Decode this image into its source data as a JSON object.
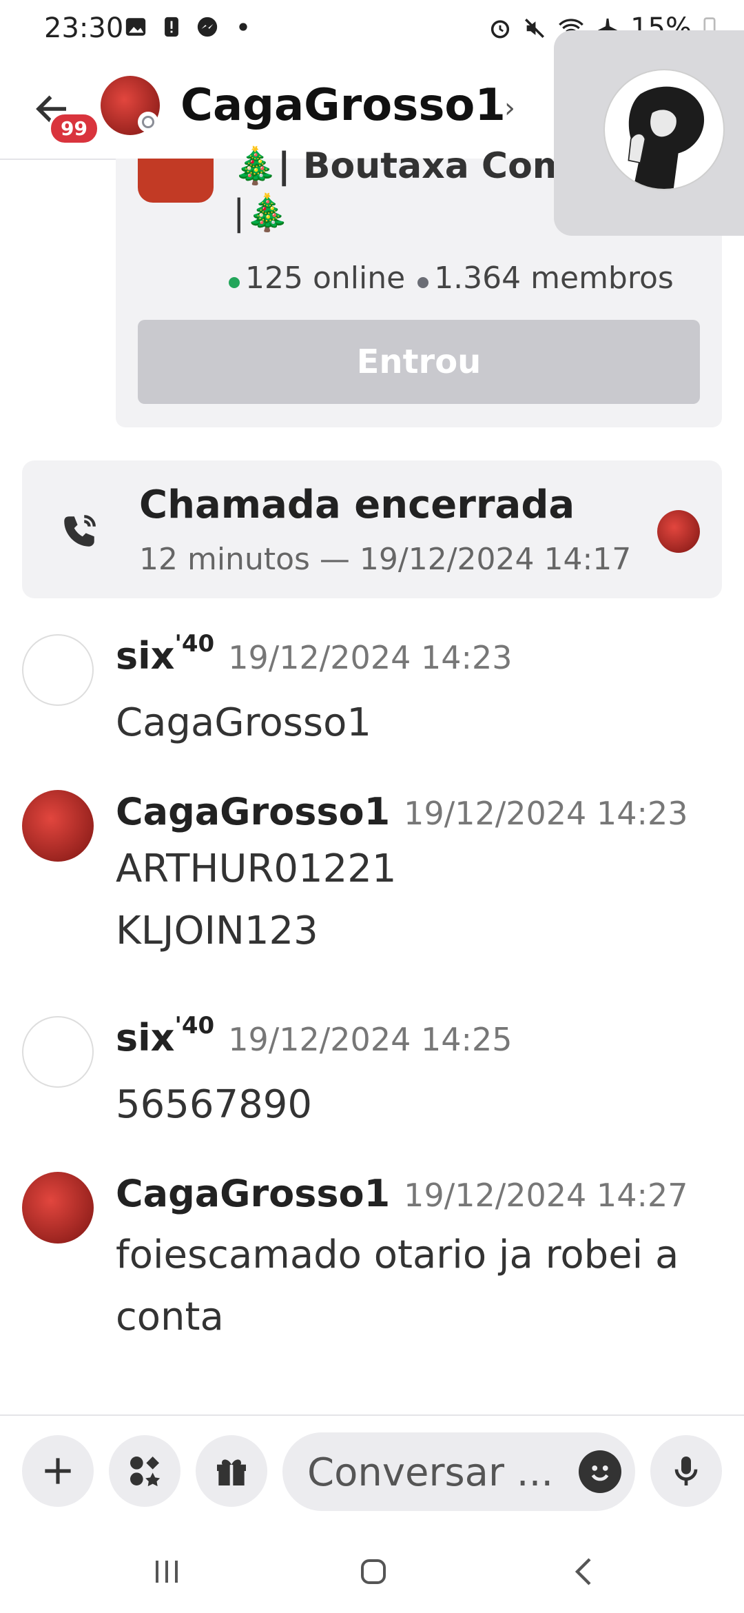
{
  "status_bar": {
    "time": "23:30",
    "battery": "15%"
  },
  "header": {
    "unread_badge": "99",
    "username": "CagaGrosso1",
    "chevron": "›"
  },
  "invite": {
    "server_name": "🎄| Boutaxa Com",
    "server_name_line2": "|🎄",
    "online": "125 online",
    "members": "1.364 membros",
    "button": "Entrou"
  },
  "call": {
    "title": "Chamada encerrada",
    "subtitle": "12 minutos — 19/12/2024 14:17"
  },
  "messages": [
    {
      "author": "six",
      "author_sup": "'40",
      "time": "19/12/2024 14:23",
      "lines": [
        "CagaGrosso1"
      ]
    },
    {
      "author": "CagaGrosso1",
      "time": "19/12/2024 14:23",
      "lines": [
        "ARTHUR01221",
        "KLJOIN123"
      ]
    },
    {
      "author": "six",
      "author_sup": "'40",
      "time": "19/12/2024 14:25",
      "lines": [
        "56567890"
      ]
    },
    {
      "author": "CagaGrosso1",
      "time": "19/12/2024 14:27",
      "lines": [
        "foiescamado otario ja robei a",
        "conta"
      ]
    }
  ],
  "input": {
    "placeholder": "Conversar ..."
  },
  "colors": {
    "accent_red": "#d9343d",
    "online_green": "#23a55a"
  }
}
